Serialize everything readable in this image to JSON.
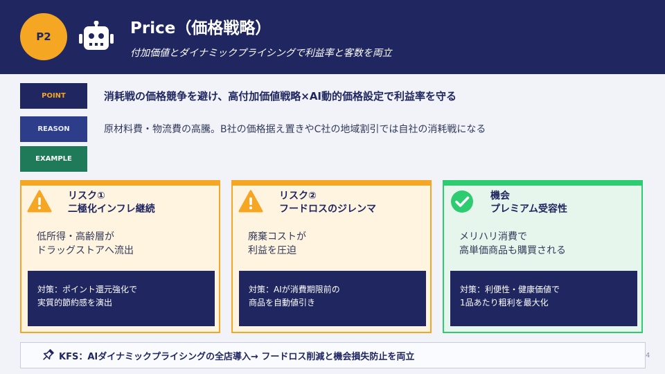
{
  "header": {
    "badge": "P2",
    "title": "Price（価格戦略）",
    "subtitle": "付加価値とダイナミックプライシングで利益率と客数を両立",
    "icon": "robot-icon"
  },
  "tags": {
    "point": "POINT",
    "reason": "REASON",
    "example": "EXAMPLE"
  },
  "point_text": "消耗戦の価格競争を避け、高付加価値戦略×AI動的価格設定で利益率を守る",
  "reason_text": "原材料費・物流費の高騰。B社の価格据え置きやC社の地域割引では自社の消耗戦になる",
  "cards": [
    {
      "icon": "warning-icon",
      "head1": "リスク①",
      "head2": "二極化インフレ継続",
      "body1": "低所得・高齢層が",
      "body2": "ドラッグストアへ流出",
      "note1": "対策：ポイント還元強化で",
      "note2": "実質的節約感を演出"
    },
    {
      "icon": "warning-icon",
      "head1": "リスク②",
      "head2": "フードロスのジレンマ",
      "body1": "廃棄コストが",
      "body2": "利益を圧迫",
      "note1": "対策：AIが消費期限前の",
      "note2": "商品を自動値引き"
    },
    {
      "icon": "check-icon",
      "head1": "機会",
      "head2": "プレミアム受容性",
      "body1": "メリハリ消費で",
      "body2": "高単価商品も購買される",
      "note1": "対策：利便性・健康価値で",
      "note2": "1品あたり粗利を最大化"
    }
  ],
  "kfs": {
    "icon": "pin-icon",
    "text": "KFS：AIダイナミックプライシングの全店導入→ フードロス削減と機会損失防止を両立"
  },
  "page_number": "4",
  "colors": {
    "navy": "#1f2660",
    "orange": "#f5a623",
    "green": "#2ecc71",
    "example_green": "#1e7a58"
  }
}
